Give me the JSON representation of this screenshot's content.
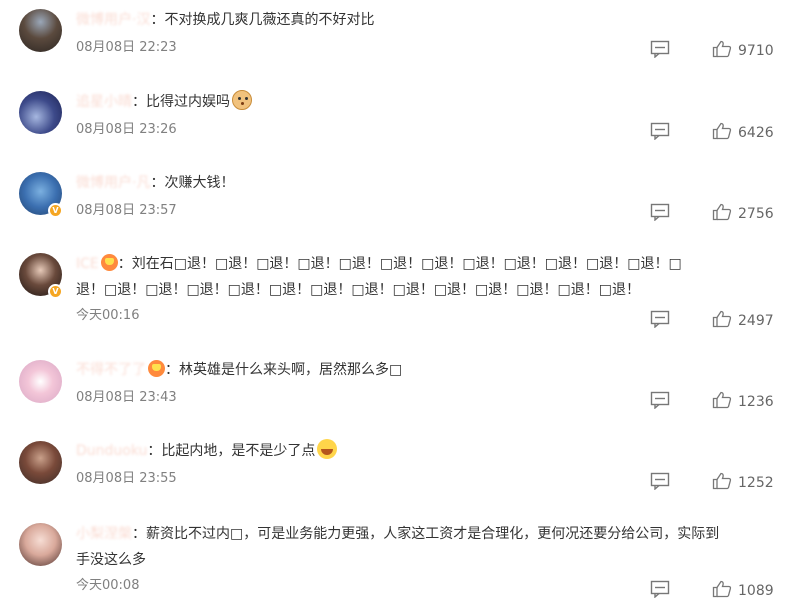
{
  "comments": [
    {
      "username": "微博用户·汉",
      "text": "不对换成几爽几薇还真的不好对比",
      "time": "08月08日 22:23",
      "likes": "9710"
    },
    {
      "username": "追星小晴",
      "text": "比得过内娱吗",
      "time": "08月08日 23:26",
      "likes": "6426"
    },
    {
      "username": "微博用户·凡",
      "text": "次赚大钱！",
      "time": "08月08日 23:57",
      "likes": "2756"
    },
    {
      "username": "ICE",
      "text_line1": "刘在石□退！□退！□退！□退！□退！□退！□退！□退！□退！□退！□退！□退！□",
      "text_line2": "退！□退！□退！□退！□退！□退！□退！□退！□退！□退！□退！□退！□退！□退！",
      "time": "今天00:16",
      "likes": "2497"
    },
    {
      "username": "不得不了了",
      "text": "林英雄是什么来头啊，居然那么多□",
      "time": "08月08日 23:43",
      "likes": "1236"
    },
    {
      "username": "Dunduoku",
      "text": "比起内地，是不是少了点",
      "time": "08月08日 23:55",
      "likes": "1252"
    },
    {
      "username": "小梨涅槃",
      "text_line1": "薪资比不过内□，可是业务能力更强，人家这工资才是合理化，更何况还要分给公司，实际到",
      "text_line2": "手没这么多",
      "time": "今天00:08",
      "likes": "1089"
    }
  ],
  "colon": "：",
  "icons": {
    "reply": "comment-bubble-icon",
    "like": "thumbs-up-icon",
    "verified": "verified-badge-icon"
  },
  "colors": {
    "username": "#eb7350",
    "meta": "#808080",
    "verified": "#f5a623"
  }
}
